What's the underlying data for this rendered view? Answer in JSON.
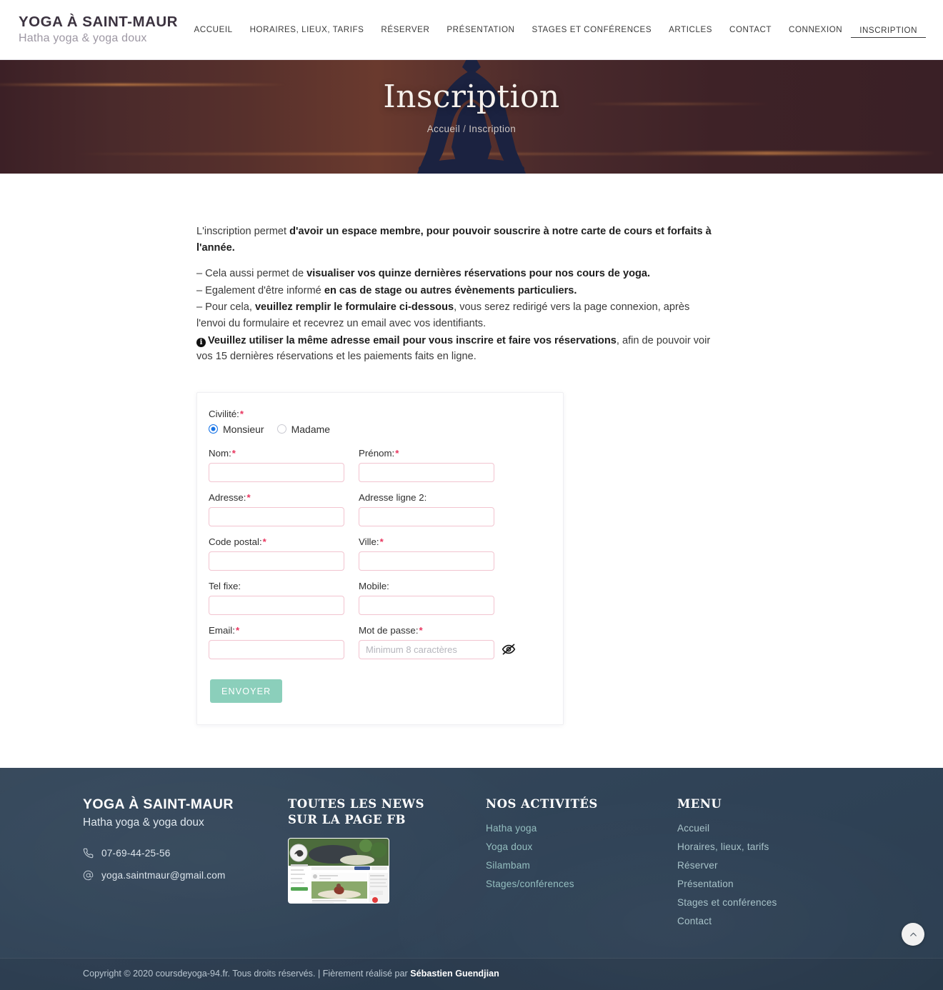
{
  "header": {
    "brand_title": "YOGA À SAINT-MAUR",
    "brand_subtitle": "Hatha yoga & yoga doux",
    "nav": [
      {
        "label": "ACCUEIL",
        "active": false
      },
      {
        "label": "HORAIRES, LIEUX, TARIFS",
        "active": false
      },
      {
        "label": "RÉSERVER",
        "active": false
      },
      {
        "label": "PRÉSENTATION",
        "active": false
      },
      {
        "label": "STAGES ET CONFÉRENCES",
        "active": false
      },
      {
        "label": "ARTICLES",
        "active": false
      },
      {
        "label": "CONTACT",
        "active": false
      },
      {
        "label": "CONNEXION",
        "active": false
      },
      {
        "label": "INSCRIPTION",
        "active": true
      }
    ]
  },
  "hero": {
    "title": "Inscription",
    "breadcrumb_home": "Accueil",
    "breadcrumb_separator": "/",
    "breadcrumb_current": "Inscription"
  },
  "intro": {
    "line1_plain": "L'inscription permet ",
    "line1_bold": "d'avoir un espace membre, pour pouvoir souscrire à notre carte de cours et forfaits à l'année.",
    "line2_plain": "– Cela aussi permet de ",
    "line2_bold": "visualiser vos quinze dernières réservations pour nos cours de yoga.",
    "line3_plain": "– Egalement d'être informé ",
    "line3_bold": "en cas de stage ou autres évènements particuliers.",
    "line4_plain_a": "– Pour cela, ",
    "line4_bold": "veuillez remplir le formulaire ci-dessous",
    "line4_plain_b": ", vous serez redirigé vers la page connexion, après l'envoi du formulaire et recevrez un email avec vos identifiants.",
    "line5_icon": "i",
    "line5_bold": "Veuillez utiliser la même adresse email pour vous inscrire et faire vos réservations",
    "line5_plain": ", afin de pouvoir voir vos 15 dernières réservations et les paiements faits en ligne."
  },
  "form": {
    "civilite_label": "Civilité:",
    "civilite_options": [
      {
        "label": "Monsieur",
        "selected": true
      },
      {
        "label": "Madame",
        "selected": false
      }
    ],
    "fields": {
      "nom": {
        "label": "Nom:",
        "required": true,
        "value": "",
        "placeholder": ""
      },
      "prenom": {
        "label": "Prénom:",
        "required": true,
        "value": "",
        "placeholder": ""
      },
      "adresse": {
        "label": "Adresse:",
        "required": true,
        "value": "",
        "placeholder": ""
      },
      "adresse2": {
        "label": "Adresse ligne 2:",
        "required": false,
        "value": "",
        "placeholder": ""
      },
      "code_postal": {
        "label": "Code postal:",
        "required": true,
        "value": "",
        "placeholder": ""
      },
      "ville": {
        "label": "Ville:",
        "required": true,
        "value": "",
        "placeholder": ""
      },
      "tel_fixe": {
        "label": "Tel fixe:",
        "required": false,
        "value": "",
        "placeholder": ""
      },
      "mobile": {
        "label": "Mobile:",
        "required": false,
        "value": "",
        "placeholder": ""
      },
      "email": {
        "label": "Email:",
        "required": true,
        "value": "",
        "placeholder": ""
      },
      "mot_de_passe": {
        "label": "Mot de passe:",
        "required": true,
        "value": "",
        "placeholder": "Minimum 8 caractères"
      }
    },
    "required_mark": "*",
    "submit_label": "ENVOYER",
    "password_toggle_icon": "eye-slash-icon"
  },
  "footer": {
    "brand_title": "YOGA À SAINT-MAUR",
    "brand_subtitle": "Hatha yoga & yoga doux",
    "phone": "07-69-44-25-56",
    "email": "yoga.saintmaur@gmail.com",
    "phone_icon": "phone-icon",
    "email_icon": "at-sign-icon",
    "news_heading_line1": "TOUTES LES NEWS",
    "news_heading_line2": "SUR LA PAGE FB",
    "activities_heading": "NOS ACTIVITÉS",
    "activities": [
      "Hatha yoga",
      "Yoga doux",
      "Silambam",
      "Stages/conférences"
    ],
    "menu_heading": "MENU",
    "menu": [
      "Accueil",
      "Horaires, lieux, tarifs",
      "Réserver",
      "Présentation",
      "Stages et conférences",
      "Contact"
    ],
    "copyright_plain": "Copyright © 2020 coursdeyoga-94.fr. Tous droits réservés. | Fièrement réalisé par ",
    "copyright_author": "Sébastien Guendjian",
    "to_top_icon": "chevron-up-icon"
  },
  "colors": {
    "accent_button": "#8bcfbb",
    "required_star": "#e8365f",
    "input_border": "#f2c4d0",
    "footer_bg": "#33475a",
    "footer_link": "#95bfc0",
    "radio_selected": "#1673e6"
  }
}
